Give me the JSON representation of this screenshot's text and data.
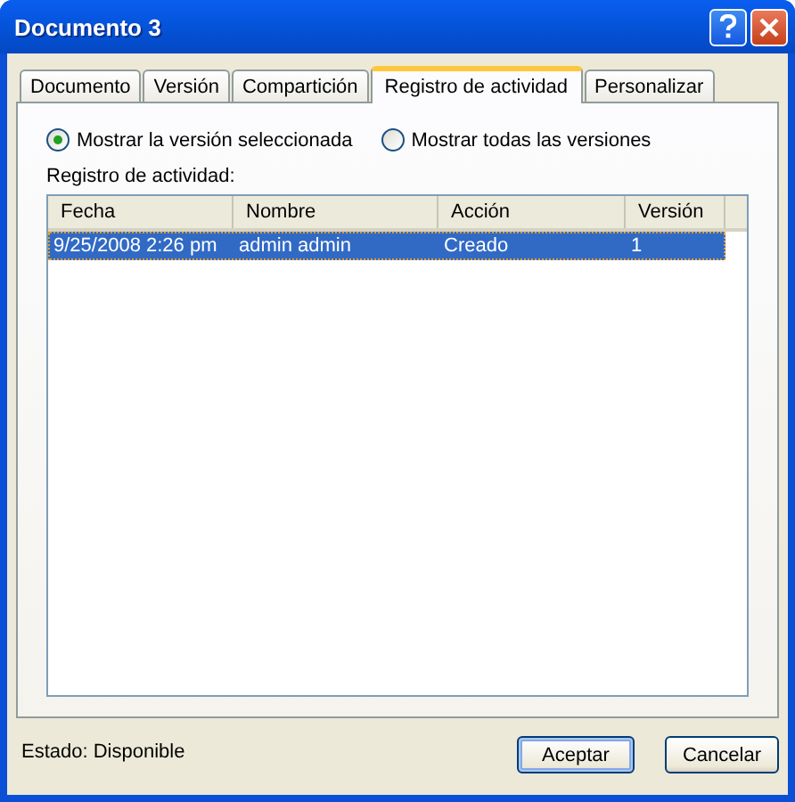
{
  "window": {
    "title": "Documento 3"
  },
  "tabs": [
    {
      "label": "Documento",
      "selected": false
    },
    {
      "label": "Versión",
      "selected": false
    },
    {
      "label": "Compartición",
      "selected": false
    },
    {
      "label": "Registro de actividad",
      "selected": true
    },
    {
      "label": "Personalizar",
      "selected": false
    }
  ],
  "view_options": [
    {
      "label": "Mostrar la versión seleccionada",
      "selected": true
    },
    {
      "label": "Mostrar todas las versiones",
      "selected": false
    }
  ],
  "activity_log": {
    "label": "Registro de actividad:",
    "columns": [
      "Fecha",
      "Nombre",
      "Acción",
      "Versión"
    ],
    "rows": [
      {
        "cells": [
          "9/25/2008 2:26 pm",
          "admin admin",
          "Creado",
          "1"
        ],
        "selected": true
      }
    ]
  },
  "status": "Estado: Disponible",
  "buttons": [
    {
      "label": "Aceptar",
      "default": true
    },
    {
      "label": "Cancelar",
      "default": false
    }
  ]
}
